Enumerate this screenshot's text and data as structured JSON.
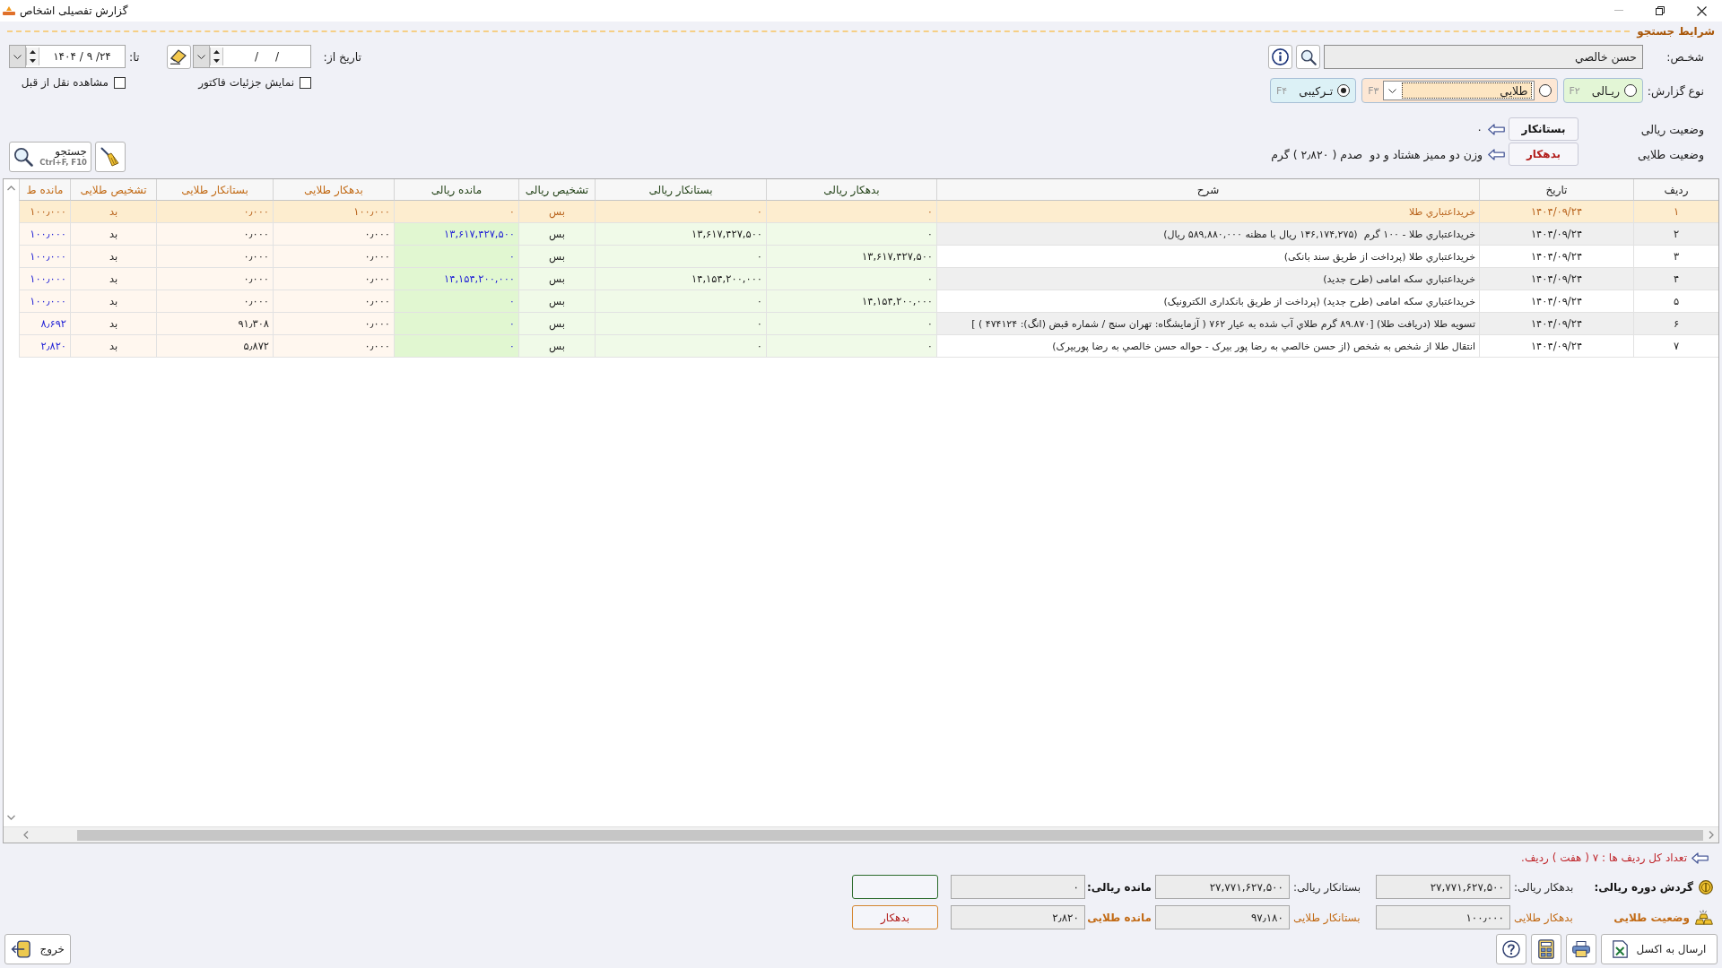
{
  "window": {
    "title": "گزارش تفصیلی اشخاص"
  },
  "search": {
    "title": "شرایط جستجو",
    "person": {
      "label": "شخـص:",
      "value": "حسن خالصي"
    },
    "report_type": {
      "label": "نوع گزارش:",
      "options": [
        {
          "label": "ریـالی",
          "shortcut": "F۲",
          "kind": "radio",
          "selected": false,
          "color": "#e3f6d6"
        },
        {
          "label": "طلایی",
          "shortcut": "F۳",
          "kind": "combo",
          "selected": false,
          "color": "#fde7d4"
        },
        {
          "label": "تـرکیبی",
          "shortcut": "F۴",
          "kind": "radio",
          "selected": true,
          "color": "#dcf1f6"
        }
      ]
    },
    "statuses": [
      {
        "label": "وضعیت ریالی",
        "value": "بستانکار",
        "kind": "credit",
        "note": "۰"
      },
      {
        "label": "وضعیت طلایی",
        "value": "بدهکار",
        "kind": "debit",
        "note": "وزن دو ممیز هشتاد و دو  صدم ( ۲٫۸۲۰ ) گرم"
      }
    ],
    "date_from": {
      "label": "تاریخ از:",
      "value": "/     /"
    },
    "date_to": {
      "label": "تا:",
      "value": "۱۴۰۴ / ۹ /۲۴"
    },
    "checkboxes": [
      {
        "label": "نمایش جزئیات فاکتور",
        "checked": false
      },
      {
        "label": "مشاهده نقل از قبل",
        "checked": false
      }
    ],
    "search_button": {
      "label": "جستجو",
      "shortcut": "Ctrl+F, F10"
    }
  },
  "table": {
    "columns": [
      {
        "label": "ردیف",
        "kind": "index"
      },
      {
        "label": "تاریخ",
        "kind": "date"
      },
      {
        "label": "شرح",
        "kind": "text"
      },
      {
        "label": "بدهکار ریالی",
        "kind": "rial"
      },
      {
        "label": "بستانکار ریالی",
        "kind": "rial"
      },
      {
        "label": "تشخیص ریالی",
        "kind": "rial_flag"
      },
      {
        "label": "مانده ریالی",
        "kind": "rial_balance"
      },
      {
        "label": "بدهکار طلایی",
        "kind": "gold"
      },
      {
        "label": "بستانکار طلایی",
        "kind": "gold"
      },
      {
        "label": "تشخیص طلایی",
        "kind": "gold_flag"
      },
      {
        "label": "مانده ط",
        "kind": "gold_balance"
      }
    ],
    "rows": [
      {
        "selected": true,
        "cells": [
          "۱",
          "۱۴۰۴/۰۹/۲۴",
          "خریداعتباري طلا",
          "۰",
          "۰",
          "بس",
          "۰",
          "۱۰۰٫۰۰۰",
          "۰٫۰۰۰",
          "بد",
          "۱۰۰٫۰۰۰"
        ]
      },
      {
        "selected": false,
        "cells": [
          "۲",
          "۱۴۰۴/۰۹/۲۴",
          "خریداعتباري طلا - ۱۰۰ گرم  (۱۳۶,۱۷۴,۲۷۵ ریال با مظنه ۵۸۹,۸۸۰,۰۰۰ ریال)",
          "۰",
          "۱۳,۶۱۷,۴۲۷,۵۰۰",
          "بس",
          "۱۳,۶۱۷,۴۲۷,۵۰۰",
          "۰٫۰۰۰",
          "۰٫۰۰۰",
          "بد",
          "۱۰۰٫۰۰۰"
        ]
      },
      {
        "selected": false,
        "cells": [
          "۳",
          "۱۴۰۴/۰۹/۲۴",
          "خریداعتباري طلا (پرداخت از طریق سند بانکی)",
          "۱۳,۶۱۷,۴۲۷,۵۰۰",
          "۰",
          "بس",
          "۰",
          "۰٫۰۰۰",
          "۰٫۰۰۰",
          "بد",
          "۱۰۰٫۰۰۰"
        ]
      },
      {
        "selected": false,
        "cells": [
          "۴",
          "۱۴۰۴/۰۹/۲۴",
          "خریداعتباري سکه امامی (طرح جدید)",
          "۰",
          "۱۴,۱۵۴,۲۰۰,۰۰۰",
          "بس",
          "۱۴,۱۵۴,۲۰۰,۰۰۰",
          "۰٫۰۰۰",
          "۰٫۰۰۰",
          "بد",
          "۱۰۰٫۰۰۰"
        ]
      },
      {
        "selected": false,
        "cells": [
          "۵",
          "۱۴۰۴/۰۹/۲۴",
          "خریداعتباري سکه امامی (طرح جدید) (پرداخت از طریق بانکداری الکترونیک)",
          "۱۴,۱۵۴,۲۰۰,۰۰۰",
          "۰",
          "بس",
          "۰",
          "۰٫۰۰۰",
          "۰٫۰۰۰",
          "بد",
          "۱۰۰٫۰۰۰"
        ]
      },
      {
        "selected": false,
        "cells": [
          "۶",
          "۱۴۰۴/۰۹/۲۴",
          "تسویه طلا (دریافت طلا) [۸۹.۸۷۰ گرم طلاي آب شده به عیار ۷۶۲ ( آزمایشگاه: تهران سنج / شماره قبض (انگ): ۴۷۴۱۲۴ ) ]",
          "۰",
          "۰",
          "بس",
          "۰",
          "۰٫۰۰۰",
          "۹۱٫۳۰۸",
          "بد",
          "۸٫۶۹۲"
        ]
      },
      {
        "selected": false,
        "cells": [
          "۷",
          "۱۴۰۴/۰۹/۲۴",
          "انتقال طلا از شخص به شخص (از حسن خالصي به رضا پور بیرک - حواله حسن خالصي به رضا پوربیرک)",
          "۰",
          "۰",
          "بس",
          "۰",
          "۰٫۰۰۰",
          "۵٫۸۷۲",
          "بد",
          "۲٫۸۲۰"
        ]
      }
    ]
  },
  "summary": {
    "row_count": "تعداد کل ردیف ها : ۷ ( هفت ) ردیف.",
    "rows": [
      {
        "kind": "rial",
        "title": "گردش دوره ریالی:",
        "debit_label": "بدهکار ریالی:",
        "debit": "۲۷,۷۷۱,۶۲۷,۵۰۰",
        "credit_label": "بستانکار ریالی:",
        "credit": "۲۷,۷۷۱,۶۲۷,۵۰۰",
        "balance_label": "مانده ریالی:",
        "balance": "۰"
      },
      {
        "kind": "gold",
        "title": "وضعیت طلایی",
        "debit_label": "بدهکار طلایی",
        "debit": "۱۰۰٫۰۰۰",
        "credit_label": "بستانکار طلایی",
        "credit": "۹۷٫۱۸۰",
        "balance_label": "مانده طلایی",
        "balance": "۲٫۸۲۰",
        "status": {
          "label": "بدهکار",
          "kind": "debit"
        }
      }
    ]
  },
  "footer": {
    "export_button": "ارسال به اکسل",
    "exit_button": "خروج"
  }
}
